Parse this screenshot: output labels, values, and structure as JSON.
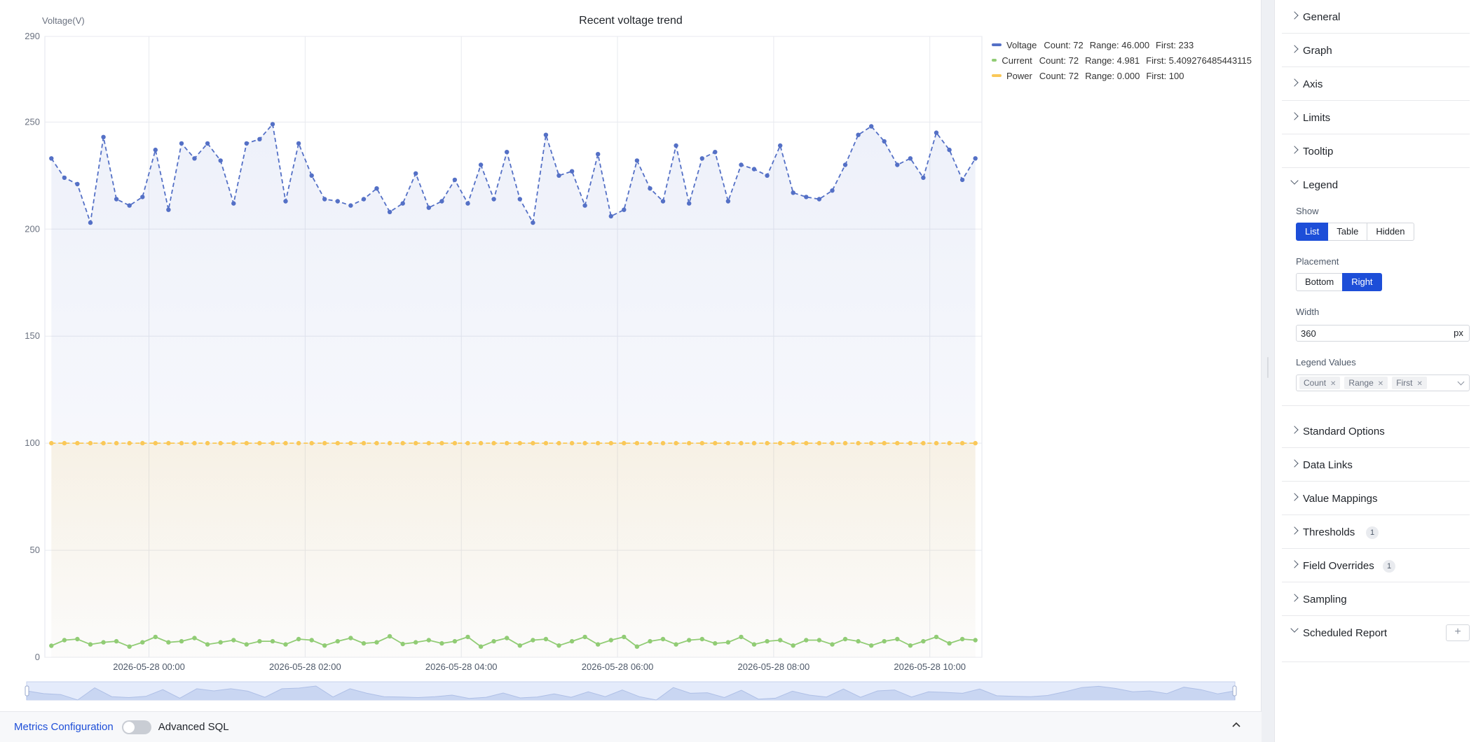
{
  "chart": {
    "title": "Recent voltage trend",
    "y_axis_title": "Voltage(V)"
  },
  "chart_data": {
    "type": "line",
    "title": "Recent voltage trend",
    "xlabel": "",
    "ylabel": "Voltage(V)",
    "ylim": [
      0,
      290
    ],
    "y_ticks": [
      0,
      50,
      100,
      150,
      200,
      250,
      290
    ],
    "x_tick_labels": [
      "2026-05-28 00:00",
      "2026-05-28 02:00",
      "2026-05-28 04:00",
      "2026-05-28 06:00",
      "2026-05-28 08:00",
      "2026-05-28 10:00"
    ],
    "x_tick_minutes": [
      0,
      120,
      240,
      360,
      480,
      600
    ],
    "x_range_minutes": [
      -80,
      640
    ],
    "x_sample_minutes": [
      -75,
      -65,
      -55,
      -45,
      -35,
      -25,
      -15,
      -5,
      5,
      15,
      25,
      35,
      45,
      55,
      65,
      75,
      85,
      95,
      105,
      115,
      125,
      135,
      145,
      155,
      165,
      175,
      185,
      195,
      205,
      215,
      225,
      235,
      245,
      255,
      265,
      275,
      285,
      295,
      305,
      315,
      325,
      335,
      345,
      355,
      365,
      375,
      385,
      395,
      405,
      415,
      425,
      435,
      445,
      455,
      465,
      475,
      485,
      495,
      505,
      515,
      525,
      535,
      545,
      555,
      565,
      575,
      585,
      595,
      605,
      615,
      625,
      635
    ],
    "grid": true,
    "legend_placement": "right",
    "series": [
      {
        "name": "Voltage",
        "color": "#5470c6",
        "dashed": true,
        "area": true,
        "values": [
          233,
          224,
          221,
          203,
          243,
          214,
          211,
          215,
          237,
          209,
          240,
          233,
          240,
          232,
          212,
          240,
          242,
          249,
          213,
          240,
          225,
          214,
          213,
          211,
          214,
          219,
          208,
          212,
          226,
          210,
          213,
          223,
          212,
          230,
          214,
          236,
          214,
          203,
          244,
          225,
          227,
          211,
          235,
          206,
          209,
          232,
          219,
          213,
          239,
          212,
          233,
          236,
          213,
          230,
          228,
          225,
          239,
          217,
          215,
          214,
          218,
          230,
          244,
          248,
          241,
          230,
          233,
          224,
          245,
          237,
          223,
          233
        ]
      },
      {
        "name": "Current",
        "color": "#91cc75",
        "dashed": false,
        "area": false,
        "values": [
          5.4,
          8,
          8.5,
          6,
          7,
          7.5,
          5,
          7,
          9.5,
          7,
          7.5,
          9,
          6,
          7,
          8,
          6,
          7.5,
          7.5,
          6,
          8.5,
          8,
          5.5,
          7.5,
          9,
          6.5,
          7,
          9.8,
          6.2,
          7,
          8,
          6.5,
          7.5,
          9.5,
          5,
          7.5,
          9,
          5.5,
          8,
          8.5,
          5.5,
          7.5,
          9.5,
          6,
          8,
          9.5,
          5,
          7.5,
          8.5,
          6,
          8,
          8.5,
          6.5,
          7,
          9.5,
          6,
          7.5,
          8,
          5.5,
          8,
          8,
          6,
          8.5,
          7.5,
          5.5,
          7.5,
          8.5,
          5.5,
          7.5,
          9.5,
          6.5,
          8.5,
          8
        ]
      },
      {
        "name": "Power",
        "color": "#fac858",
        "dashed": true,
        "area": true,
        "values": [
          100,
          100,
          100,
          100,
          100,
          100,
          100,
          100,
          100,
          100,
          100,
          100,
          100,
          100,
          100,
          100,
          100,
          100,
          100,
          100,
          100,
          100,
          100,
          100,
          100,
          100,
          100,
          100,
          100,
          100,
          100,
          100,
          100,
          100,
          100,
          100,
          100,
          100,
          100,
          100,
          100,
          100,
          100,
          100,
          100,
          100,
          100,
          100,
          100,
          100,
          100,
          100,
          100,
          100,
          100,
          100,
          100,
          100,
          100,
          100,
          100,
          100,
          100,
          100,
          100,
          100,
          100,
          100,
          100,
          100,
          100,
          100
        ]
      }
    ]
  },
  "legend": {
    "items": [
      {
        "name": "Voltage",
        "color": "#5470c6",
        "count": "Count: 72",
        "range": "Range: 46.000",
        "first": "First: 233"
      },
      {
        "name": "Current",
        "color": "#91cc75",
        "count": "Count: 72",
        "range": "Range: 4.981",
        "first": "First: 5.409276485443115"
      },
      {
        "name": "Power",
        "color": "#fac858",
        "count": "Count: 72",
        "range": "Range: 0.000",
        "first": "First: 100"
      }
    ]
  },
  "footer": {
    "metrics_label": "Metrics Configuration",
    "advanced_sql_label": "Advanced SQL",
    "advanced_sql_enabled": false
  },
  "options": {
    "sections": {
      "general": "General",
      "graph": "Graph",
      "axis": "Axis",
      "limits": "Limits",
      "tooltip": "Tooltip",
      "legend": "Legend",
      "standard_options": "Standard Options",
      "data_links": "Data Links",
      "value_mappings": "Value Mappings",
      "thresholds": "Thresholds",
      "field_overrides": "Field Overrides",
      "sampling": "Sampling",
      "scheduled_report": "Scheduled Report"
    },
    "thresholds_count": "1",
    "field_overrides_count": "1",
    "legend": {
      "show_label": "Show",
      "show_options": [
        "List",
        "Table",
        "Hidden"
      ],
      "show_selected": "List",
      "placement_label": "Placement",
      "placement_options": [
        "Bottom",
        "Right"
      ],
      "placement_selected": "Right",
      "width_label": "Width",
      "width_value": "360",
      "width_unit": "px",
      "values_label": "Legend Values",
      "values_tags": [
        "Count",
        "Range",
        "First"
      ]
    }
  },
  "colors": {
    "accent": "#1d4ed8",
    "voltage": "#5470c6",
    "current": "#91cc75",
    "power": "#fac858"
  },
  "icons": {
    "section_collapsed": "chevron-right-icon",
    "section_expanded": "chevron-down-icon",
    "footer_collapse": "chevron-up-icon",
    "add": "plus-icon",
    "tag_remove": "close-icon"
  }
}
